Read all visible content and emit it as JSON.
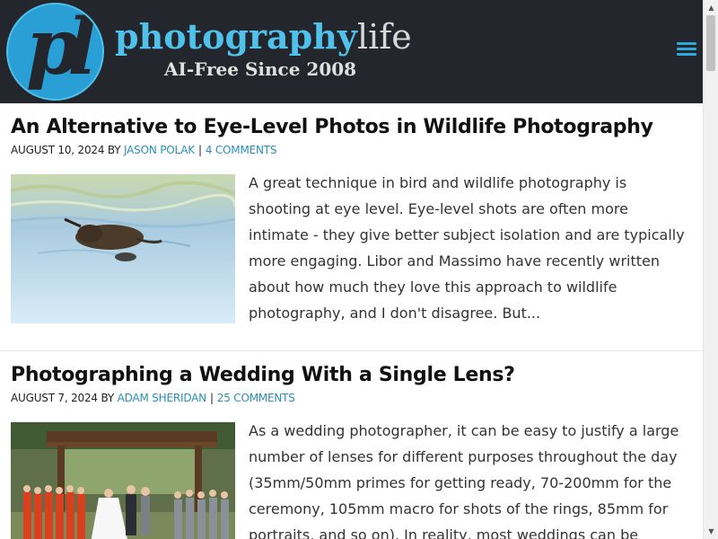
{
  "header": {
    "logo_text": "pl",
    "brand_main": "photography",
    "brand_suffix": "life",
    "tagline": "AI-Free Since 2008"
  },
  "colors": {
    "header_bg": "#23272d",
    "accent": "#4fc1ea",
    "link": "#2a8fb8"
  },
  "icons": {
    "menu": "hamburger-menu-icon",
    "scroll_up": "triangle-up-icon",
    "scroll_down": "triangle-down-icon"
  },
  "articles": [
    {
      "title": "An Alternative to Eye-Level Photos in Wildlife Photography",
      "date": "AUGUST 10, 2024",
      "by": "BY",
      "author": "JASON POLAK",
      "separator": "|",
      "comments": "4 COMMENTS",
      "excerpt": "A great technique in bird and wildlife photography is shooting at eye level. Eye-level shots are often more intimate - they give better subject isolation and are typically more engaging. Libor and Massimo have recently written about how much they love this approach to wildlife photography, and I don't disagree. But..."
    },
    {
      "title": "Photographing a Wedding With a Single Lens?",
      "date": "AUGUST 7, 2024",
      "by": "BY",
      "author": "ADAM SHERIDAN",
      "separator": "|",
      "comments": "25 COMMENTS",
      "excerpt": "As a wedding photographer, it can be easy to justify a large number of lenses for different purposes throughout the day (35mm/50mm primes for getting ready, 70-200mm for the ceremony, 105mm macro for shots of the rings, 85mm for portraits, and so on). In reality, most weddings can be"
    }
  ]
}
